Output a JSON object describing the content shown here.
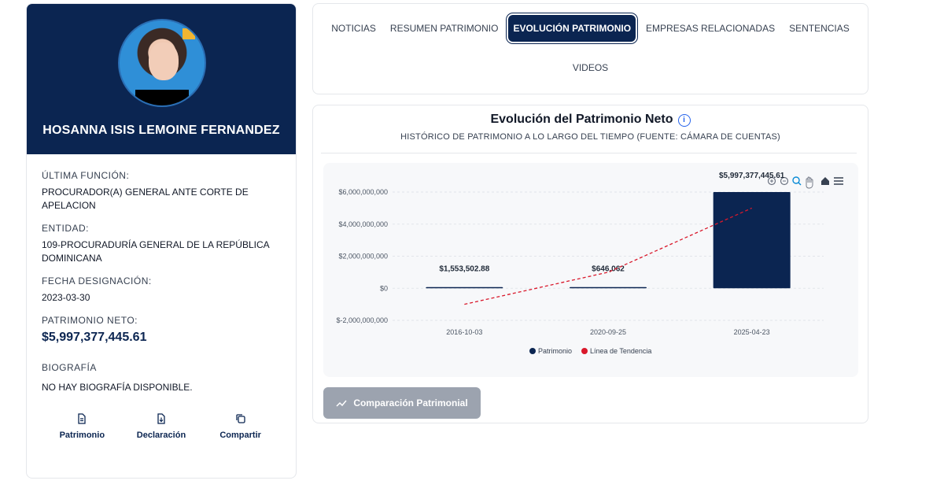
{
  "profile": {
    "name": "HOSANNA ISIS LEMOINE FERNANDEZ",
    "fields": {
      "funcion_label": "ÚLTIMA FUNCIÓN:",
      "funcion_value": "PROCURADOR(A) GENERAL ANTE CORTE DE APELACION",
      "entidad_label": "ENTIDAD:",
      "entidad_value": "109-PROCURADURÍA GENERAL DE LA REPÚBLICA DOMINICANA",
      "fecha_label": "FECHA DESIGNACIÓN:",
      "fecha_value": "2023-03-30",
      "patrimonio_label": "PATRIMONIO NETO:",
      "patrimonio_value": "$5,997,377,445.61",
      "bio_label": "BIOGRAFÍA",
      "bio_value": "NO HAY BIOGRAFÍA DISPONIBLE."
    },
    "actions": {
      "patrimonio": "Patrimonio",
      "declaracion": "Declaración",
      "compartir": "Compartir"
    }
  },
  "tabs": {
    "noticias": "NOTICIAS",
    "resumen": "RESUMEN PATRIMONIO",
    "evolucion": "EVOLUCIÓN PATRIMONIO",
    "empresas": "EMPRESAS RELACIONADAS",
    "sentencias": "SENTENCIAS",
    "videos": "VIDEOS"
  },
  "chart_card": {
    "title": "Evolución del Patrimonio Neto",
    "info_glyph": "i",
    "subtitle": "HISTÓRICO DE PATRIMONIO A LO LARGO DEL TIEMPO (FUENTE: CÁMARA DE CUENTAS)",
    "compare_button": "Comparación Patrimonial"
  },
  "chart_data": {
    "type": "bar",
    "categories": [
      "2016-10-03",
      "2020-09-25",
      "2025-04-23"
    ],
    "series": [
      {
        "name": "Patrimonio",
        "values": [
          1553502.88,
          646062,
          5997377445.61
        ],
        "color": "#0b2551"
      },
      {
        "name": "Línea de Tendencia",
        "values": [
          -1000000000,
          1000000000,
          5000000000
        ],
        "color": "#d9182b",
        "style": "dashed-line"
      }
    ],
    "data_labels": [
      "$1,553,502.88",
      "$646,062",
      "$5,997,377,445.61"
    ],
    "yticks": [
      "$6,000,000,000",
      "$4,000,000,000",
      "$2,000,000,000",
      "$0",
      "$-2,000,000,000"
    ],
    "ylim": [
      -2000000000,
      6000000000
    ],
    "legend": "bottom-center",
    "grid": true
  },
  "colors": {
    "brand": "#0b2551",
    "trend": "#d9182b"
  }
}
